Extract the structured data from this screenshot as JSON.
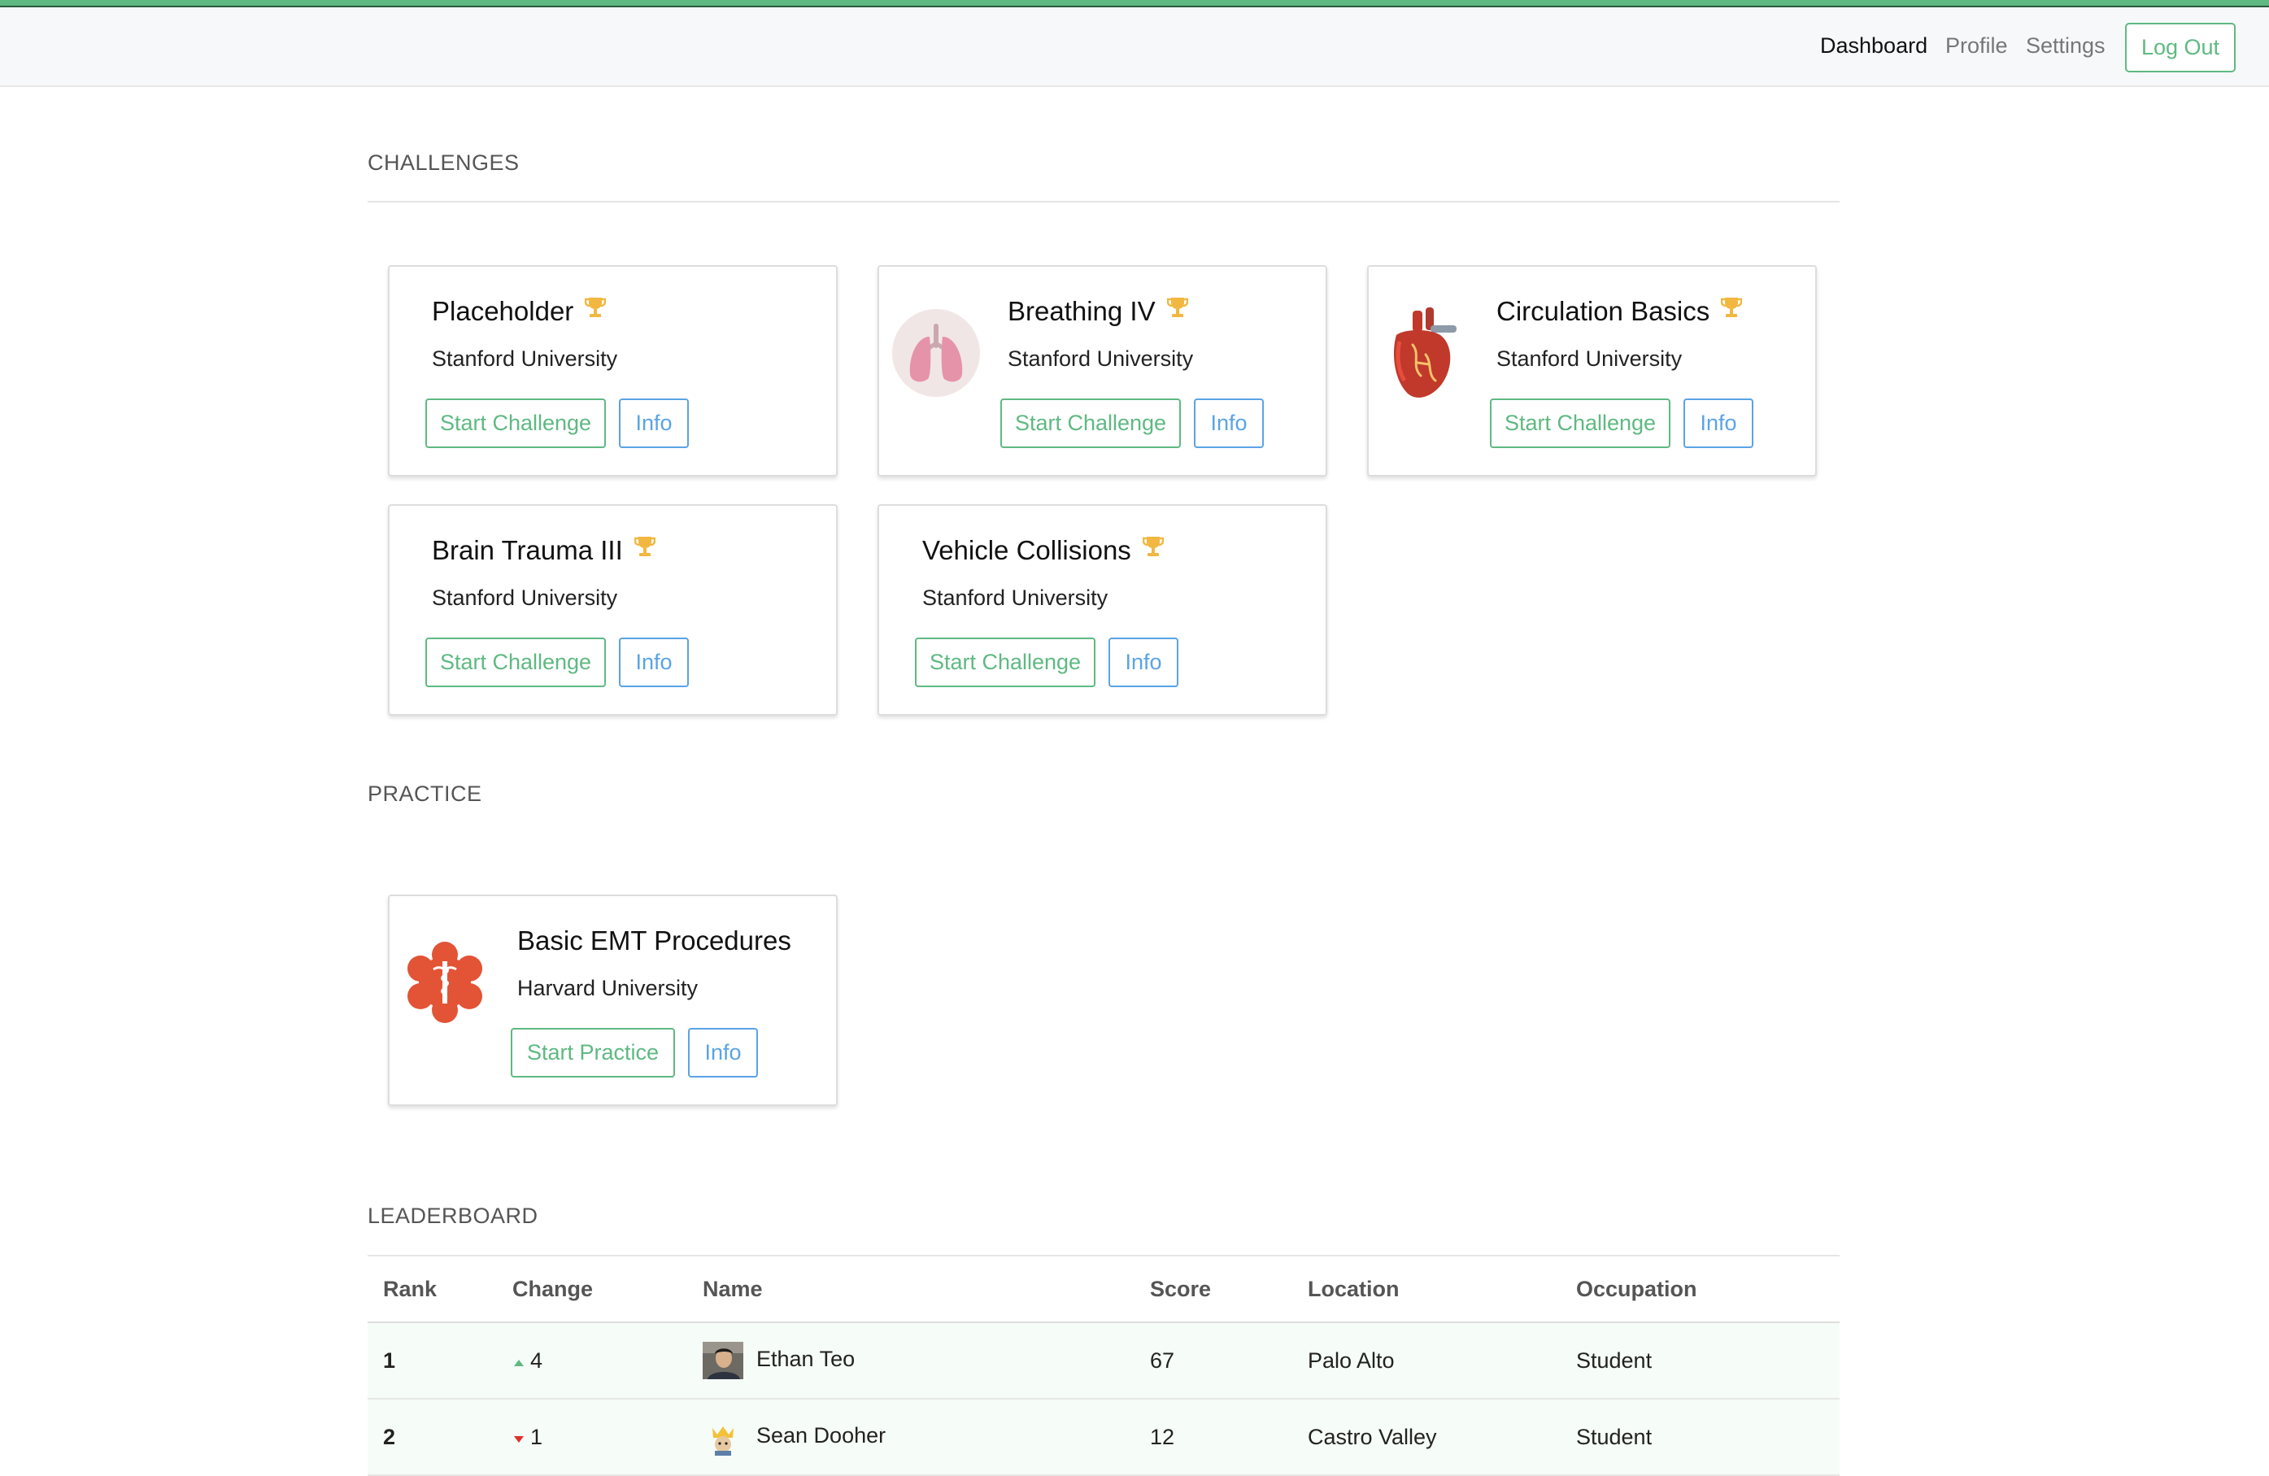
{
  "nav": {
    "links": [
      "Dashboard",
      "Profile",
      "Settings"
    ],
    "logout": "Log Out"
  },
  "sections": {
    "challenges": "CHALLENGES",
    "practice": "PRACTICE",
    "leaderboard": "LEADERBOARD"
  },
  "challenges": [
    {
      "title": "Placeholder",
      "org": "Stanford University",
      "start": "Start Challenge",
      "info": "Info",
      "icon": "none"
    },
    {
      "title": "Breathing IV",
      "org": "Stanford University",
      "start": "Start Challenge",
      "info": "Info",
      "icon": "lungs-icon"
    },
    {
      "title": "Circulation Basics",
      "org": "Stanford University",
      "start": "Start Challenge",
      "info": "Info",
      "icon": "heart-icon"
    },
    {
      "title": "Brain Trauma III",
      "org": "Stanford University",
      "start": "Start Challenge",
      "info": "Info",
      "icon": "none"
    },
    {
      "title": "Vehicle Collisions",
      "org": "Stanford University",
      "start": "Start Challenge",
      "info": "Info",
      "icon": "none"
    }
  ],
  "practice": [
    {
      "title": "Basic EMT Procedures",
      "org": "Harvard University",
      "start": "Start Practice",
      "info": "Info",
      "icon": "medical-star-icon"
    }
  ],
  "leaderboard": {
    "columns": [
      "Rank",
      "Change",
      "Name",
      "Score",
      "Location",
      "Occupation"
    ],
    "rows": [
      {
        "rank": "1",
        "direction": "up",
        "change": "4",
        "name": "Ethan Teo",
        "score": "67",
        "location": "Palo Alto",
        "occupation": "Student"
      },
      {
        "rank": "2",
        "direction": "down",
        "change": "1",
        "name": "Sean Dooher",
        "score": "12",
        "location": "Castro Valley",
        "occupation": "Student"
      }
    ]
  },
  "colors": {
    "accent": "#5fb982",
    "info": "#5aa3e6",
    "trophy": "#f2b740",
    "down": "#e0302a"
  }
}
